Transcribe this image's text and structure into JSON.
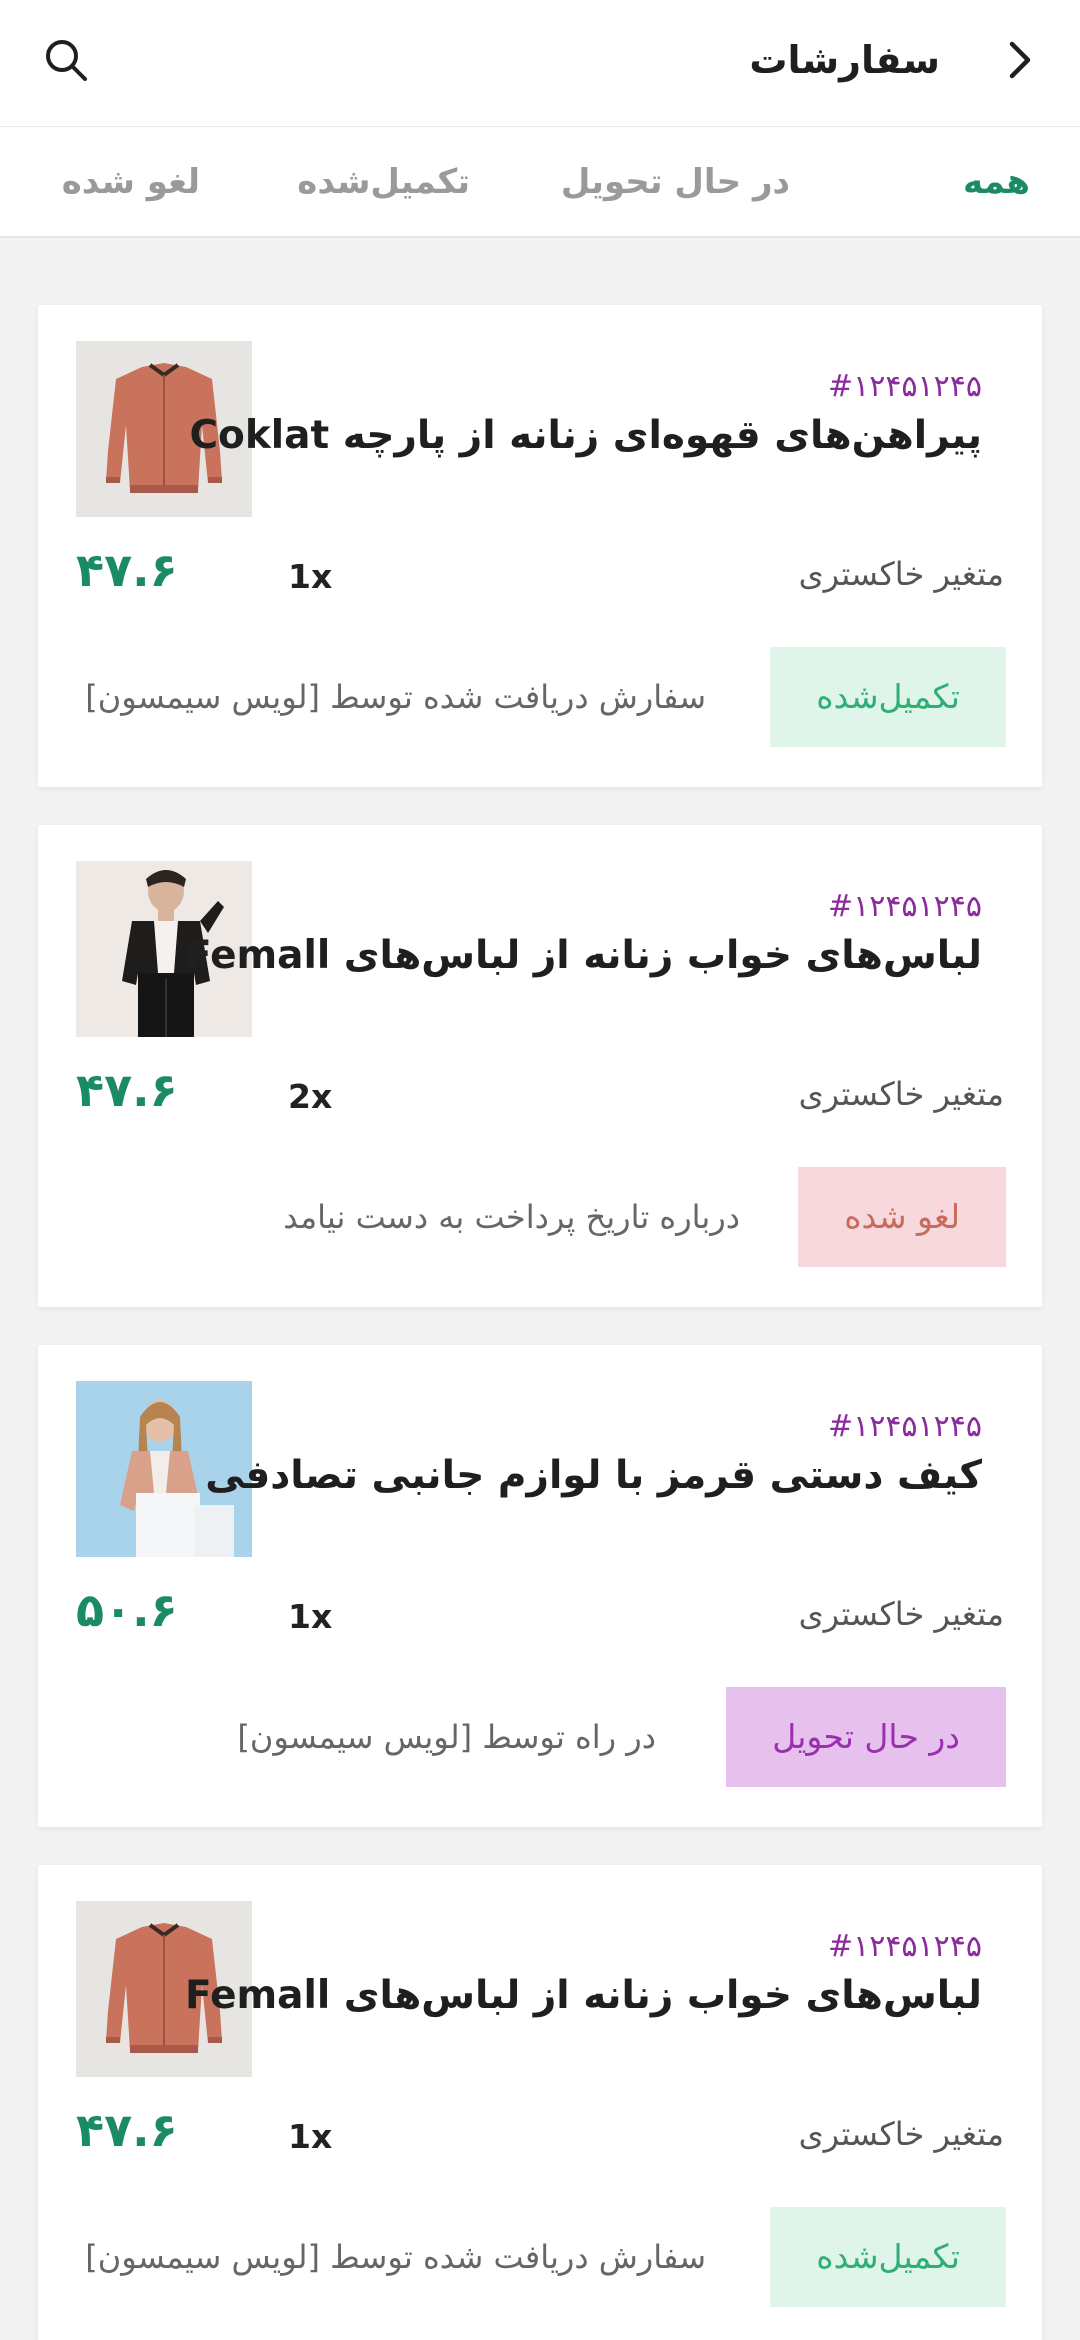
{
  "header": {
    "title": "سفارشات",
    "back_icon": "chevron-right-icon",
    "search_icon": "search-icon"
  },
  "tabs": [
    {
      "label": "همه",
      "active": true
    },
    {
      "label": "در حال تحویل",
      "active": false
    },
    {
      "label": "تکمیل‌شده",
      "active": false
    },
    {
      "label": "لغو شده",
      "active": false
    }
  ],
  "colors": {
    "accent": "#1b8a67",
    "order_id": "#8a2a9e",
    "completed_bg": "#dff5e9",
    "completed_text": "#2fae76",
    "cancelled_bg": "#f7d9dd",
    "cancelled_text": "#c86a5e",
    "shipping_bg": "#e7c1ee",
    "shipping_text": "#9a2fb0"
  },
  "orders": [
    {
      "order_id": "#۱۲۴۵۱۲۴۵",
      "product_name": "پیراهن‌های قهوه‌ای زنانه از پارچه Coklat",
      "variant": "متغیر خاکستری",
      "quantity": "1x",
      "price": "۴۷.۶",
      "status": "تکمیل‌شده",
      "status_note": "سفارش دریافت شده توسط [لویس سیمسون]",
      "image": "brown-jacket"
    },
    {
      "order_id": "#۱۲۴۵۱۲۴۵",
      "product_name": "لباس‌های خواب زنانه از لباس‌های Femall",
      "variant": "متغیر خاکستری",
      "quantity": "2x",
      "price": "۴۷.۶",
      "status": "لغو شده",
      "status_note": "درباره تاریخ پرداخت به دست نیامد",
      "image": "man-in-black-jacket"
    },
    {
      "order_id": "#۱۲۴۵۱۲۴۵",
      "product_name": "کیف دستی قرمز با لوازم جانبی تصادفی",
      "variant": "متغیر خاکستری",
      "quantity": "1x",
      "price": "۵۰.۶",
      "status": "در حال تحویل",
      "status_note": "در راه توسط [لویس سیمسون]",
      "image": "woman-in-pink-jacket"
    },
    {
      "order_id": "#۱۲۴۵۱۲۴۵",
      "product_name": "لباس‌های خواب زنانه از لباس‌های Femall",
      "variant": "متغیر خاکستری",
      "quantity": "1x",
      "price": "۴۷.۶",
      "status": "تکمیل‌شده",
      "status_note": "سفارش دریافت شده توسط [لویس سیمسون]",
      "image": "brown-jacket"
    }
  ]
}
